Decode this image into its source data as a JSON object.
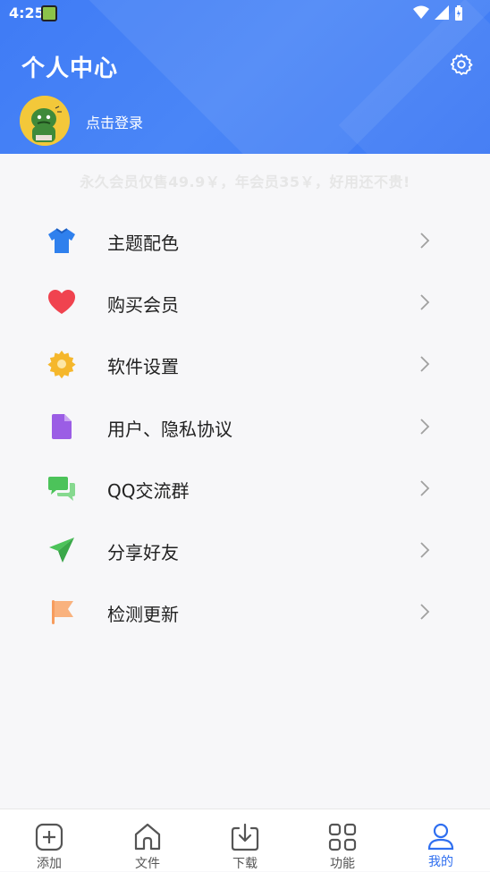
{
  "statusbar": {
    "time": "4:25"
  },
  "header": {
    "title": "个人中心",
    "login_text": "点击登录"
  },
  "promo": "永久会员仅售49.9￥，年会员35￥，好用还不贵!",
  "menu": [
    {
      "label": "主题配色",
      "icon": "shirt-icon",
      "color": "#2f80ed"
    },
    {
      "label": "购买会员",
      "icon": "heart-icon",
      "color": "#f0434f"
    },
    {
      "label": "软件设置",
      "icon": "gear-icon",
      "color": "#f5b72c"
    },
    {
      "label": "用户、隐私协议",
      "icon": "document-icon",
      "color": "#9b5de5"
    },
    {
      "label": "QQ交流群",
      "icon": "chat-icon",
      "color": "#4cc35a"
    },
    {
      "label": "分享好友",
      "icon": "paper-plane-icon",
      "color": "#4cc35a"
    },
    {
      "label": "检测更新",
      "icon": "flag-icon",
      "color": "#f79c5d"
    }
  ],
  "tabbar": {
    "items": [
      {
        "label": "添加",
        "icon": "add-icon"
      },
      {
        "label": "文件",
        "icon": "home-icon"
      },
      {
        "label": "下载",
        "icon": "download-icon"
      },
      {
        "label": "功能",
        "icon": "grid-icon"
      },
      {
        "label": "我的",
        "icon": "user-icon",
        "active": true
      }
    ],
    "active_color": "#2f6ff0"
  }
}
